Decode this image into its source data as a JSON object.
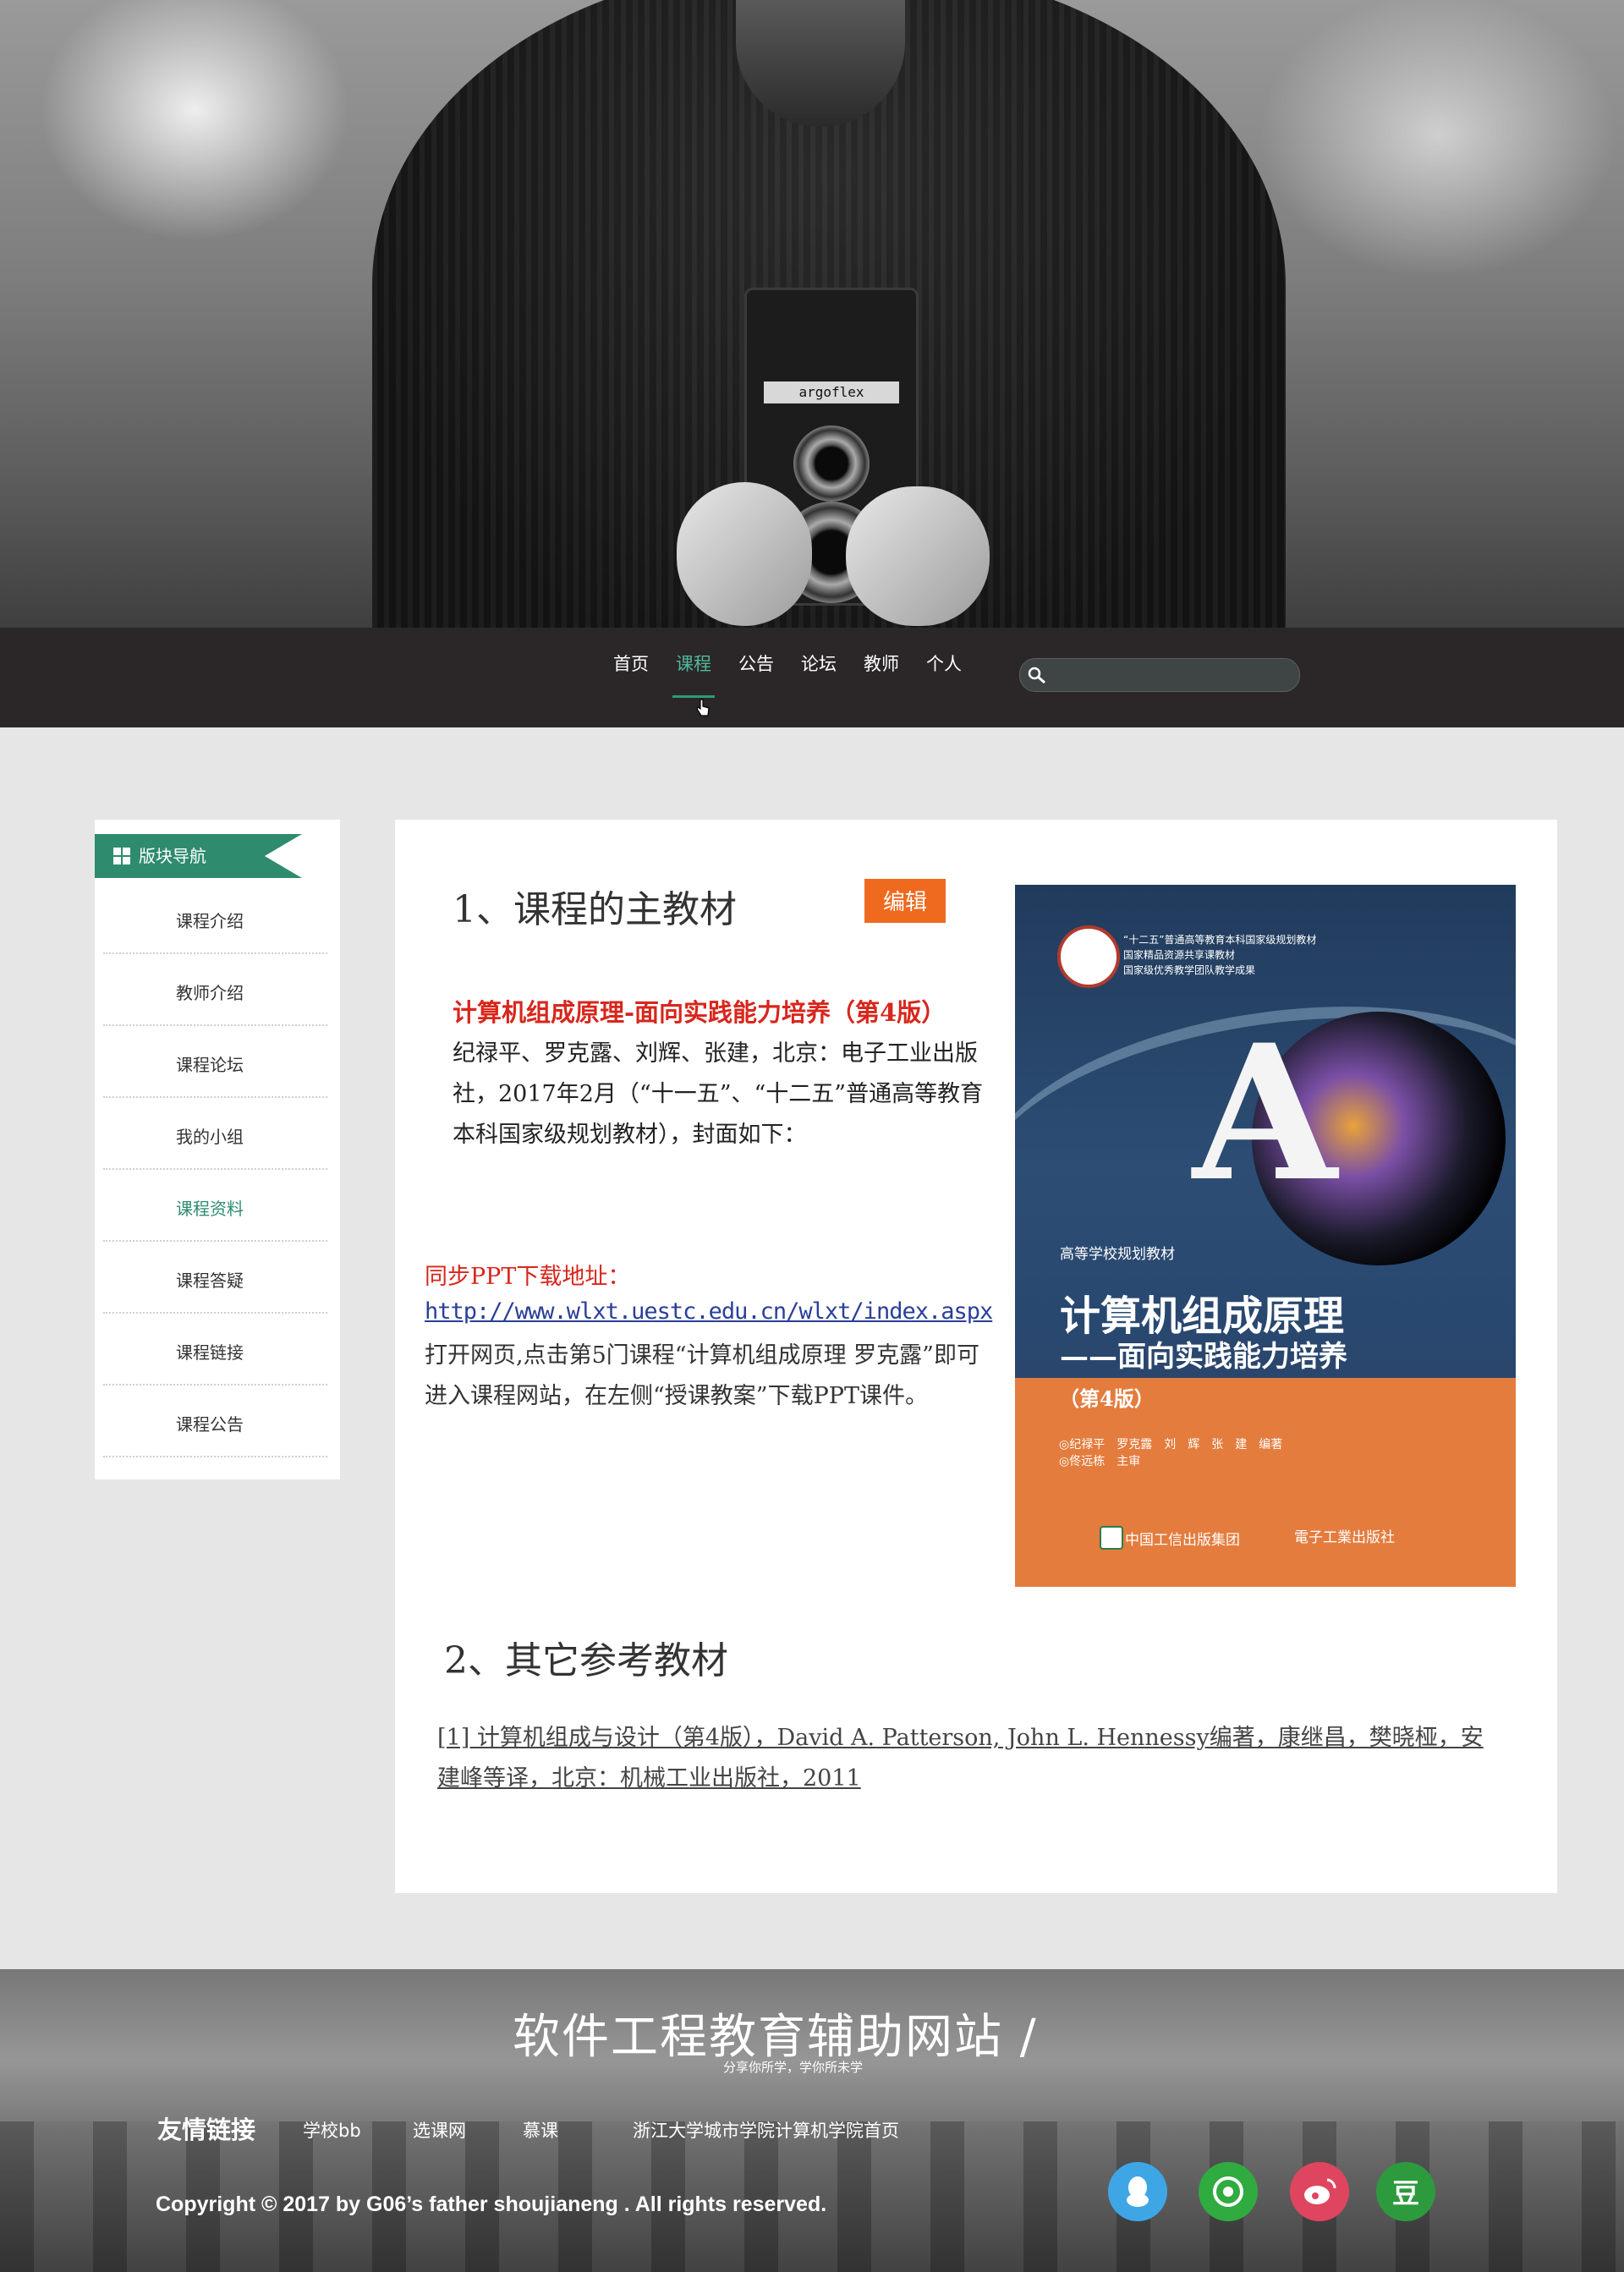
{
  "nav": {
    "items": [
      {
        "label": "首页"
      },
      {
        "label": "课程"
      },
      {
        "label": "公告"
      },
      {
        "label": "论坛"
      },
      {
        "label": "教师"
      },
      {
        "label": "个人"
      }
    ],
    "active_index": 1,
    "search_placeholder": ""
  },
  "sidebar": {
    "title": "版块导航",
    "items": [
      {
        "label": "课程介绍"
      },
      {
        "label": "教师介绍"
      },
      {
        "label": "课程论坛"
      },
      {
        "label": "我的小组"
      },
      {
        "label": "课程资料"
      },
      {
        "label": "课程答疑"
      },
      {
        "label": "课程链接"
      },
      {
        "label": "课程公告"
      }
    ],
    "active_index": 4,
    "accent_color": "#2e8b6e"
  },
  "main": {
    "section1_title": "1、课程的主教材",
    "edit_label": "编辑",
    "book_title": "计算机组成原理-面向实践能力培养（第4版）",
    "book_desc": "纪禄平、罗克露、刘辉、张建，北京：电子工业出版社，2017年2月（“十一五”、“十二五”普通高等教育本科国家级规划教材），封面如下：",
    "ppt_label": "同步PPT下载地址：",
    "ppt_url": "http://www.wlxt.uestc.edu.cn/wlxt/index.aspx",
    "ppt_desc": "打开网页,点击第5门课程“计算机组成原理 罗克露”即可进入课程网站，在左侧“授课教案”下载PPT课件。",
    "section2_title": "2、其它参考教材",
    "reference": "[1] 计算机组成与设计（第4版），David A. Patterson, John L. Hennessy编著，康继昌，樊晓桠，安建峰等译，北京：机械工业出版社，2011"
  },
  "cover": {
    "top_line1": "“十二五”普通高等教育本科国家级规划教材",
    "top_line2": "国家精品资源共享课教材",
    "top_line3": "国家级优秀教学团队教学成果",
    "series": "高等学校规划教材",
    "title": "计算机组成原理",
    "subtitle": "——面向实践能力培养",
    "edition": "（第4版）",
    "authors1": "◎纪禄平　罗克露　刘　辉　张　建　编著",
    "authors2": "◎佟远栋　主审",
    "publisher1": "中国工信出版集团",
    "publisher2": "電子工業出版社"
  },
  "footer": {
    "site_title": "软件工程教育辅助网站 /",
    "slogan": "分享你所学，学你所未学",
    "links_label": "友情链接",
    "links": [
      {
        "label": "学校bb"
      },
      {
        "label": "选课网"
      },
      {
        "label": "慕课"
      },
      {
        "label": "浙江大学城市学院计算机学院首页"
      }
    ],
    "copyright": "Copyright © 2017 by G06’s father shoujianeng . All rights reserved.",
    "social": [
      {
        "icon": "qq-icon",
        "color": "#3fa6e6"
      },
      {
        "icon": "wechat-moments-icon",
        "color": "#2fab3f"
      },
      {
        "icon": "weibo-icon",
        "color": "#e0455f"
      },
      {
        "icon": "douban-icon",
        "color": "#2e9a3e",
        "label": "豆"
      }
    ]
  }
}
